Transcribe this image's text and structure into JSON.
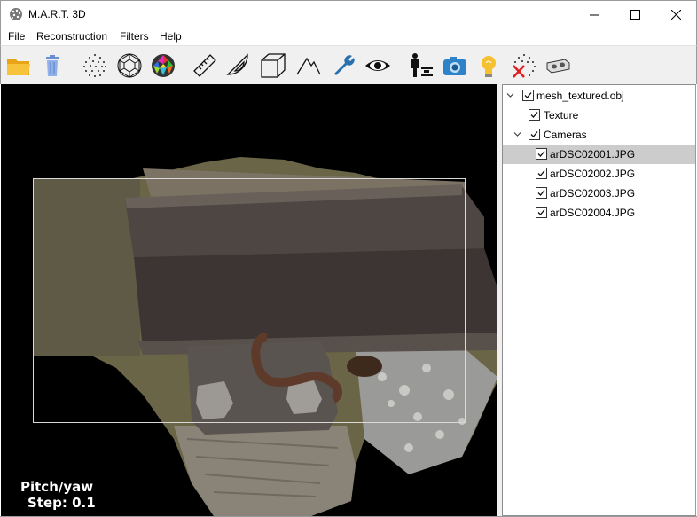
{
  "window": {
    "title": "M.A.R.T. 3D"
  },
  "menu": {
    "items": [
      "File",
      "Reconstruction",
      "Filters",
      "Help"
    ]
  },
  "toolbar": {
    "icons": [
      "open-folder",
      "trash",
      "point-cloud",
      "mesh-wireframe",
      "mesh-colored",
      "ruler",
      "protractor",
      "bounding-box",
      "mountain",
      "wrench",
      "eye",
      "person-wall",
      "camera",
      "light-bulb",
      "remove-points",
      "vr-headset"
    ]
  },
  "viewport": {
    "hud_mode": "Pitch/yaw",
    "hud_step": "Step: 0.1"
  },
  "tree": {
    "root": {
      "label": "mesh_textured.obj",
      "checked": true,
      "expanded": true
    },
    "texture": {
      "label": "Texture",
      "checked": true
    },
    "cameras": {
      "label": "Cameras",
      "checked": true,
      "expanded": true
    },
    "camera_items": [
      {
        "label": "arDSC02001.JPG",
        "checked": true,
        "selected": true
      },
      {
        "label": "arDSC02002.JPG",
        "checked": true,
        "selected": false
      },
      {
        "label": "arDSC02003.JPG",
        "checked": true,
        "selected": false
      },
      {
        "label": "arDSC02004.JPG",
        "checked": true,
        "selected": false
      }
    ]
  },
  "colors": {
    "selection": "#cccccc",
    "toolbar_bg": "#f0f0f0",
    "viewport_bg": "#000000"
  }
}
